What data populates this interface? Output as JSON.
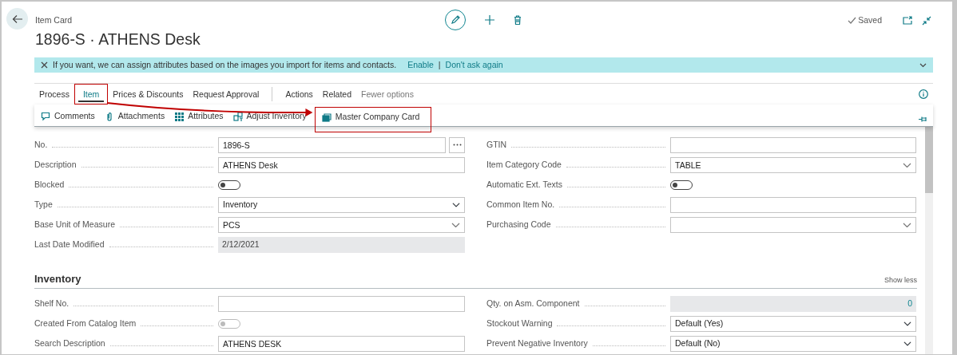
{
  "header": {
    "breadcrumb": "Item Card",
    "title": "1896-S · ATHENS Desk",
    "status": "Saved"
  },
  "notification": {
    "message": "If you want, we can assign attributes based on the images you import for items and contacts.",
    "links": [
      "Enable",
      "Don't ask again"
    ],
    "separator": "|"
  },
  "action_groups": [
    [
      {
        "label": "Process",
        "selected": false,
        "highlighted": false,
        "kind": "tab"
      },
      {
        "label": "Item",
        "selected": true,
        "highlighted": true,
        "kind": "tab"
      },
      {
        "label": "Prices & Discounts",
        "selected": false,
        "highlighted": false,
        "kind": "tab"
      },
      {
        "label": "Request Approval",
        "selected": false,
        "highlighted": false,
        "kind": "tab"
      }
    ],
    [
      {
        "label": "Actions",
        "selected": false,
        "highlighted": false,
        "kind": "tab"
      },
      {
        "label": "Related",
        "selected": false,
        "highlighted": false,
        "kind": "tab"
      },
      {
        "label": "Fewer options",
        "selected": false,
        "highlighted": false,
        "kind": "toggle"
      }
    ]
  ],
  "sub_actions": [
    {
      "label": "Comments",
      "highlighted": false
    },
    {
      "label": "Attachments",
      "highlighted": false
    },
    {
      "label": "Attributes",
      "highlighted": false
    },
    {
      "label": "Adjust Inventory",
      "highlighted": false
    },
    {
      "label": "Master Company Card",
      "highlighted": true
    }
  ],
  "general": {
    "left": [
      {
        "label": "No.",
        "kind": "lookup",
        "value": "1896-S"
      },
      {
        "label": "Description",
        "kind": "text",
        "value": "ATHENS Desk"
      },
      {
        "label": "Blocked",
        "kind": "toggle",
        "on": false,
        "disabled": false
      },
      {
        "label": "Type",
        "kind": "select",
        "value": "Inventory"
      },
      {
        "label": "Base Unit of Measure",
        "kind": "combo",
        "value": "PCS"
      },
      {
        "label": "Last Date Modified",
        "kind": "readonly",
        "value": "2/12/2021"
      }
    ],
    "right": [
      {
        "label": "GTIN",
        "kind": "text"
      },
      {
        "label": "Item Category Code",
        "kind": "combo",
        "value": "TABLE"
      },
      {
        "label": "Automatic Ext. Texts",
        "kind": "toggle",
        "on": false,
        "disabled": false
      },
      {
        "label": "Common Item No.",
        "kind": "text"
      },
      {
        "label": "Purchasing Code",
        "kind": "combo"
      }
    ]
  },
  "inventory": {
    "title": "Inventory",
    "show_less": "Show less",
    "left": [
      {
        "label": "Shelf No.",
        "kind": "text"
      },
      {
        "label": "Created From Catalog Item",
        "kind": "toggle",
        "on": false,
        "disabled": true
      },
      {
        "label": "Search Description",
        "kind": "text",
        "value": "ATHENS DESK"
      }
    ],
    "right": [
      {
        "label": "Qty. on Asm. Component",
        "kind": "readonly_number",
        "value": "0"
      },
      {
        "label": "Stockout Warning",
        "kind": "select",
        "value": "Default (Yes)"
      },
      {
        "label": "Prevent Negative Inventory",
        "kind": "select",
        "value": "Default (No)"
      }
    ]
  }
}
